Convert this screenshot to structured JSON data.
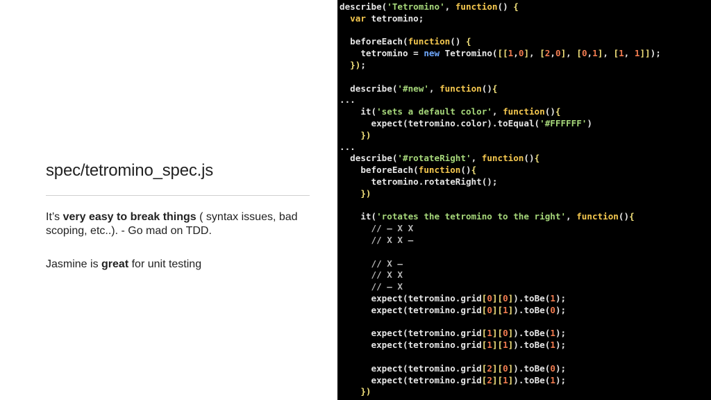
{
  "slide": {
    "title": "spec/tetromino_spec.js",
    "paragraph1": [
      {
        "text": "It’s ",
        "bold": false
      },
      {
        "text": "very easy to break things",
        "bold": true
      },
      {
        "text": " ( syntax issues, bad scoping, etc..). - Go mad on TDD.",
        "bold": false
      }
    ],
    "paragraph2": [
      {
        "text": "Jasmine is ",
        "bold": false
      },
      {
        "text": "great",
        "bold": true
      },
      {
        "text": " for unit testing",
        "bold": false
      }
    ]
  },
  "colors": {
    "string": "#a6d77a",
    "keyword": "#f5c84f",
    "number": "#f07b4f",
    "new": "#6fa8ff",
    "bracket": "#f2e17b",
    "comment": "#b9b9b9",
    "plain": "#e6e6e6"
  },
  "code_lines": [
    [
      [
        "plain",
        "describe("
      ],
      [
        "str",
        "'Tetromino'"
      ],
      [
        "plain",
        ", "
      ],
      [
        "kw",
        "function"
      ],
      [
        "plain",
        "() "
      ],
      [
        "br",
        "{"
      ]
    ],
    [
      [
        "plain",
        "  "
      ],
      [
        "kw",
        "var"
      ],
      [
        "plain",
        " tetromino;"
      ]
    ],
    [],
    [
      [
        "plain",
        "  beforeEach("
      ],
      [
        "kw",
        "function"
      ],
      [
        "plain",
        "() "
      ],
      [
        "br",
        "{"
      ]
    ],
    [
      [
        "plain",
        "    tetromino = "
      ],
      [
        "new",
        "new"
      ],
      [
        "plain",
        " Tetromino("
      ],
      [
        "br",
        "[["
      ],
      [
        "num",
        "1"
      ],
      [
        "plain",
        ","
      ],
      [
        "num",
        "0"
      ],
      [
        "br",
        "]"
      ],
      [
        "plain",
        ", "
      ],
      [
        "br",
        "["
      ],
      [
        "num",
        "2"
      ],
      [
        "plain",
        ","
      ],
      [
        "num",
        "0"
      ],
      [
        "br",
        "]"
      ],
      [
        "plain",
        ", "
      ],
      [
        "br",
        "["
      ],
      [
        "num",
        "0"
      ],
      [
        "plain",
        ","
      ],
      [
        "num",
        "1"
      ],
      [
        "br",
        "]"
      ],
      [
        "plain",
        ", "
      ],
      [
        "br",
        "["
      ],
      [
        "num",
        "1"
      ],
      [
        "plain",
        ", "
      ],
      [
        "num",
        "1"
      ],
      [
        "br",
        "]]"
      ],
      [
        "plain",
        ");"
      ]
    ],
    [
      [
        "plain",
        "  "
      ],
      [
        "br",
        "})"
      ],
      [
        "plain",
        ";"
      ]
    ],
    [],
    [
      [
        "plain",
        "  describe("
      ],
      [
        "str",
        "'#new'"
      ],
      [
        "plain",
        ", "
      ],
      [
        "kw",
        "function"
      ],
      [
        "plain",
        "()"
      ],
      [
        "br",
        "{"
      ]
    ],
    [
      [
        "plain",
        "..."
      ]
    ],
    [
      [
        "plain",
        "    it("
      ],
      [
        "str",
        "'sets a default color'"
      ],
      [
        "plain",
        ", "
      ],
      [
        "kw",
        "function"
      ],
      [
        "plain",
        "()"
      ],
      [
        "br",
        "{"
      ]
    ],
    [
      [
        "plain",
        "      expect(tetromino.color).toEqual("
      ],
      [
        "str",
        "'#FFFFFF'"
      ],
      [
        "plain",
        ")"
      ]
    ],
    [
      [
        "plain",
        "    "
      ],
      [
        "br",
        "})"
      ]
    ],
    [
      [
        "plain",
        "..."
      ]
    ],
    [
      [
        "plain",
        "  describe("
      ],
      [
        "str",
        "'#rotateRight'"
      ],
      [
        "plain",
        ", "
      ],
      [
        "kw",
        "function"
      ],
      [
        "plain",
        "()"
      ],
      [
        "br",
        "{"
      ]
    ],
    [
      [
        "plain",
        "    beforeEach("
      ],
      [
        "kw",
        "function"
      ],
      [
        "plain",
        "()"
      ],
      [
        "br",
        "{"
      ]
    ],
    [
      [
        "plain",
        "      tetromino.rotateRight();"
      ]
    ],
    [
      [
        "plain",
        "    "
      ],
      [
        "br",
        "})"
      ]
    ],
    [],
    [
      [
        "plain",
        "    it("
      ],
      [
        "str",
        "'rotates the tetromino to the right'"
      ],
      [
        "plain",
        ", "
      ],
      [
        "kw",
        "function"
      ],
      [
        "plain",
        "()"
      ],
      [
        "br",
        "{"
      ]
    ],
    [
      [
        "cm",
        "      // – X X"
      ]
    ],
    [
      [
        "cm",
        "      // X X –"
      ]
    ],
    [],
    [
      [
        "cm",
        "      // X –"
      ]
    ],
    [
      [
        "cm",
        "      // X X"
      ]
    ],
    [
      [
        "cm",
        "      // – X"
      ]
    ],
    [
      [
        "plain",
        "      expect(tetromino.grid"
      ],
      [
        "br",
        "["
      ],
      [
        "num",
        "0"
      ],
      [
        "br",
        "]["
      ],
      [
        "num",
        "0"
      ],
      [
        "br",
        "]"
      ],
      [
        "plain",
        ").toBe("
      ],
      [
        "num",
        "1"
      ],
      [
        "plain",
        ");"
      ]
    ],
    [
      [
        "plain",
        "      expect(tetromino.grid"
      ],
      [
        "br",
        "["
      ],
      [
        "num",
        "0"
      ],
      [
        "br",
        "]["
      ],
      [
        "num",
        "1"
      ],
      [
        "br",
        "]"
      ],
      [
        "plain",
        ").toBe("
      ],
      [
        "num",
        "0"
      ],
      [
        "plain",
        ");"
      ]
    ],
    [],
    [
      [
        "plain",
        "      expect(tetromino.grid"
      ],
      [
        "br",
        "["
      ],
      [
        "num",
        "1"
      ],
      [
        "br",
        "]["
      ],
      [
        "num",
        "0"
      ],
      [
        "br",
        "]"
      ],
      [
        "plain",
        ").toBe("
      ],
      [
        "num",
        "1"
      ],
      [
        "plain",
        ");"
      ]
    ],
    [
      [
        "plain",
        "      expect(tetromino.grid"
      ],
      [
        "br",
        "["
      ],
      [
        "num",
        "1"
      ],
      [
        "br",
        "]["
      ],
      [
        "num",
        "1"
      ],
      [
        "br",
        "]"
      ],
      [
        "plain",
        ").toBe("
      ],
      [
        "num",
        "1"
      ],
      [
        "plain",
        ");"
      ]
    ],
    [],
    [
      [
        "plain",
        "      expect(tetromino.grid"
      ],
      [
        "br",
        "["
      ],
      [
        "num",
        "2"
      ],
      [
        "br",
        "]["
      ],
      [
        "num",
        "0"
      ],
      [
        "br",
        "]"
      ],
      [
        "plain",
        ").toBe("
      ],
      [
        "num",
        "0"
      ],
      [
        "plain",
        ");"
      ]
    ],
    [
      [
        "plain",
        "      expect(tetromino.grid"
      ],
      [
        "br",
        "["
      ],
      [
        "num",
        "2"
      ],
      [
        "br",
        "]["
      ],
      [
        "num",
        "1"
      ],
      [
        "br",
        "]"
      ],
      [
        "plain",
        ").toBe("
      ],
      [
        "num",
        "1"
      ],
      [
        "plain",
        ");"
      ]
    ],
    [
      [
        "plain",
        "    "
      ],
      [
        "br",
        "})"
      ]
    ]
  ]
}
